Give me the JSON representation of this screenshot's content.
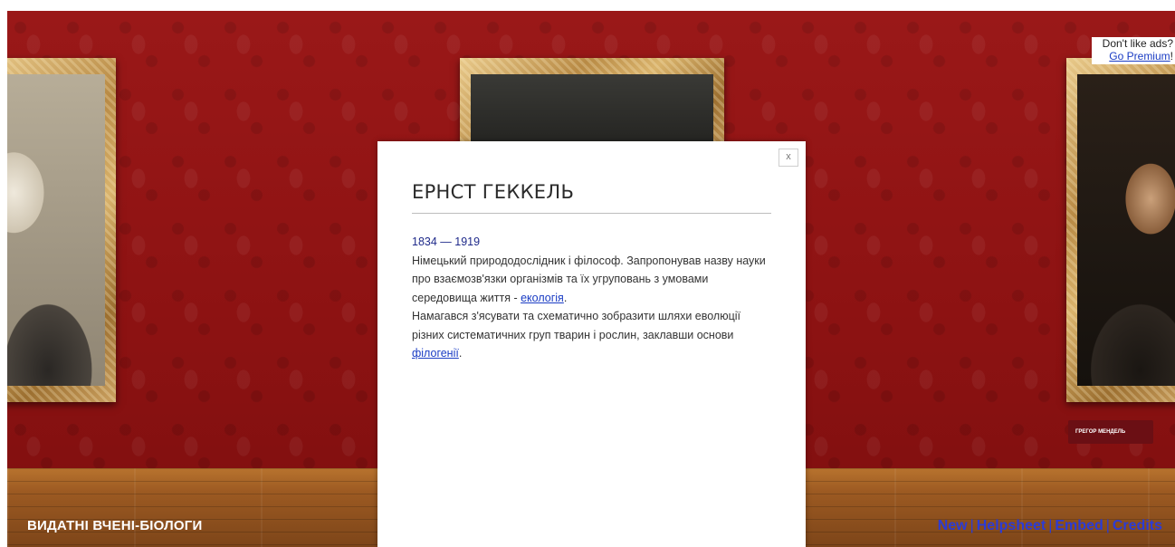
{
  "ad_notice": {
    "text": "Don't like ads?",
    "link_label": "Go Premium",
    "suffix": "!"
  },
  "gallery": {
    "title": "ВИДАТНІ ВЧЕНІ-БІОЛОГИ",
    "nameplate_right": "ГРЕГОР МЕНДЕЛЬ"
  },
  "footer_links": {
    "new": "New",
    "helpsheet": "Helpsheet",
    "embed": "Embed",
    "credits": "Credits",
    "separator": "|"
  },
  "modal": {
    "close_label": "x",
    "title": "ЕРНСТ ГЕККЕЛЬ",
    "years": "1834 — 1919",
    "paragraph1_before_link": "Німецький природодослідник і філософ. Запропонував назву науки про взаємозв'язки організмів та їх угруповань з умовами середовища життя - ",
    "paragraph1_link": "екологія",
    "paragraph1_after_link": ".",
    "paragraph2_before_link": "Намагався з'ясувати та схематично зобразити шляхи еволюції різних систематичних груп тварин і рослин, заклавши основи ",
    "paragraph2_link": "філогенії",
    "paragraph2_after_link": "."
  },
  "colors": {
    "wall": "#8d1414",
    "floor": "#9c5a22",
    "link": "#2b3bd6",
    "modal_bg": "#ffffff"
  }
}
